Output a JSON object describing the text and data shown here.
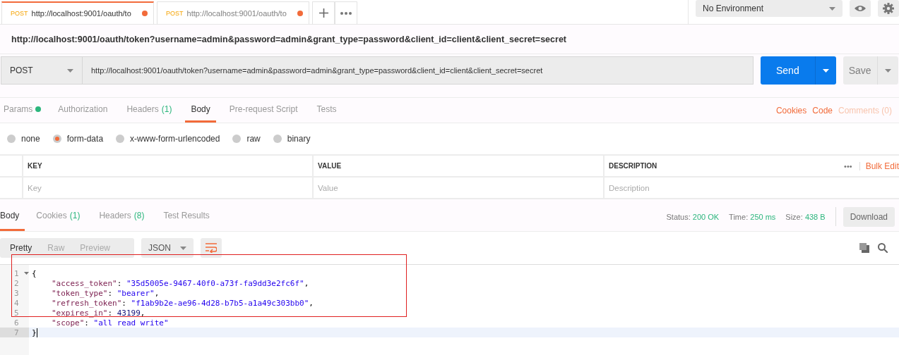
{
  "request_tabs": [
    {
      "method": "POST",
      "title": "http://localhost:9001/oauth/to",
      "selected": true,
      "unsaved": true
    },
    {
      "method": "POST",
      "title": "http://localhost:9001/oauth/to",
      "selected": false,
      "unsaved": true
    }
  ],
  "environment": {
    "value": "No Environment"
  },
  "request_title": "http://localhost:9001/oauth/token?username=admin&password=admin&grant_type=password&client_id=client&client_secret=secret",
  "method": "POST",
  "url": "http://localhost:9001/oauth/token?username=admin&password=admin&grant_type=password&client_id=client&client_secret=secret",
  "send_label": "Send",
  "save_label": "Save",
  "section_tabs": [
    {
      "label": "Params",
      "dot": true,
      "selected": false
    },
    {
      "label": "Authorization",
      "dot": false,
      "selected": false
    },
    {
      "label": "Headers",
      "count": "(1)",
      "dot": false,
      "selected": false
    },
    {
      "label": "Body",
      "dot": false,
      "selected": true
    },
    {
      "label": "Pre-request Script",
      "dot": false,
      "selected": false
    },
    {
      "label": "Tests",
      "dot": false,
      "selected": false
    }
  ],
  "section_links": [
    {
      "label": "Cookies",
      "disabled": false
    },
    {
      "label": "Code",
      "disabled": false
    },
    {
      "label": "Comments (0)",
      "disabled": true
    }
  ],
  "body_types": [
    {
      "label": "none",
      "selected": false
    },
    {
      "label": "form-data",
      "selected": true
    },
    {
      "label": "x-www-form-urlencoded",
      "selected": false
    },
    {
      "label": "raw",
      "selected": false
    },
    {
      "label": "binary",
      "selected": false
    }
  ],
  "table": {
    "columns": [
      "KEY",
      "VALUE",
      "DESCRIPTION"
    ],
    "more": "•••",
    "bulk_edit": "Bulk Edit",
    "placeholders": [
      "Key",
      "Value",
      "Description"
    ]
  },
  "response_tabs": [
    {
      "label": "Body",
      "selected": true
    },
    {
      "label": "Cookies",
      "count": "(1)",
      "selected": false
    },
    {
      "label": "Headers",
      "count": "(8)",
      "selected": false
    },
    {
      "label": "Test Results",
      "selected": false
    }
  ],
  "status": [
    {
      "label": "Status:",
      "value": "200 OK"
    },
    {
      "label": "Time:",
      "value": "250 ms"
    },
    {
      "label": "Size:",
      "value": "438 B"
    }
  ],
  "download_label": "Download",
  "view_modes": [
    {
      "label": "Pretty",
      "selected": true
    },
    {
      "label": "Raw",
      "selected": false
    },
    {
      "label": "Preview",
      "selected": false
    }
  ],
  "format": "JSON",
  "code": [
    {
      "number": "1",
      "fold": true,
      "current": false,
      "tokens": [
        {
          "kind": "punct",
          "text": "{"
        }
      ]
    },
    {
      "number": "2",
      "fold": false,
      "current": false,
      "tokens": [
        {
          "kind": "key",
          "text": "\"access_token\""
        },
        {
          "kind": "punct",
          "text": ": "
        },
        {
          "kind": "string",
          "text": "\"35d5005e-9467-40f0-a73f-fa9dd3e2fc6f\""
        },
        {
          "kind": "punct",
          "text": ","
        }
      ]
    },
    {
      "number": "3",
      "fold": false,
      "current": false,
      "tokens": [
        {
          "kind": "key",
          "text": "\"token_type\""
        },
        {
          "kind": "punct",
          "text": ": "
        },
        {
          "kind": "string",
          "text": "\"bearer\""
        },
        {
          "kind": "punct",
          "text": ","
        }
      ]
    },
    {
      "number": "4",
      "fold": false,
      "current": false,
      "tokens": [
        {
          "kind": "key",
          "text": "\"refresh_token\""
        },
        {
          "kind": "punct",
          "text": ": "
        },
        {
          "kind": "string",
          "text": "\"f1ab9b2e-ae96-4d28-b7b5-a1a49c303bb0\""
        },
        {
          "kind": "punct",
          "text": ","
        }
      ]
    },
    {
      "number": "5",
      "fold": false,
      "current": false,
      "tokens": [
        {
          "kind": "key",
          "text": "\"expires_in\""
        },
        {
          "kind": "punct",
          "text": ": "
        },
        {
          "kind": "number",
          "text": "43199"
        },
        {
          "kind": "punct",
          "text": ","
        }
      ]
    },
    {
      "number": "6",
      "fold": false,
      "current": false,
      "tokens": [
        {
          "kind": "key",
          "text": "\"scope\""
        },
        {
          "kind": "punct",
          "text": ": "
        },
        {
          "kind": "string",
          "text": "\"all read write\""
        }
      ]
    },
    {
      "number": "7",
      "fold": false,
      "current": true,
      "tokens": [
        {
          "kind": "punct",
          "text": "}"
        }
      ]
    }
  ]
}
